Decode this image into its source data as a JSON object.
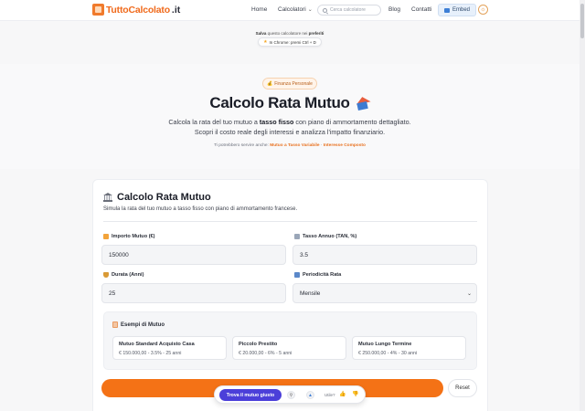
{
  "header": {
    "logo_text": "TuttoCalcolato",
    "logo_tld": ".it",
    "nav": {
      "home": "Home",
      "calcolatori": "Calcolatori",
      "blog": "Blog",
      "contatti": "Contatti"
    },
    "search_placeholder": "Cerca calcolatore",
    "embed_label": "Embed"
  },
  "save_hint": {
    "prefix": "Salva",
    "middle": " questo calcolatore nei ",
    "strong": "preferiti",
    "chrome_text": "In Chrome: premi Ctrl + D"
  },
  "hero": {
    "badge": "Finanza Personale",
    "title": "Calcolo Rata Mutuo",
    "subtitle_1a": "Calcola la rata del tuo mutuo a ",
    "subtitle_1b": "tasso fisso",
    "subtitle_1c": " con piano di ammortamento dettagliato.",
    "subtitle_2": "Scopri il costo reale degli interessi e analizza l'impatto finanziario.",
    "related_prefix": "Ti potrebbero servire anche:",
    "related_1": "Mutuo a Tasso Variabile",
    "related_sep": " · ",
    "related_2": "Interesse Composto"
  },
  "card": {
    "title": "Calcolo Rata Mutuo",
    "description": "Simula la rata del tuo mutuo a tasso fisso con piano di ammortamento francese.",
    "fields": {
      "importo": {
        "label": "Importo Mutuo (€)",
        "value": "150000"
      },
      "tasso": {
        "label": "Tasso Annuo (TAN, %)",
        "value": "3.5"
      },
      "durata": {
        "label": "Durata (Anni)",
        "value": "25"
      },
      "periodicita": {
        "label": "Periodicità Rata",
        "value": "Mensile"
      }
    },
    "examples": {
      "title": "Esempi di Mutuo",
      "items": [
        {
          "name": "Mutuo Standard Acquisto Casa",
          "detail": "€ 150.000,00 - 3.5% - 25 anni"
        },
        {
          "name": "Piccolo Prestito",
          "detail": "€ 20.000,00 - 6% - 5 anni"
        },
        {
          "name": "Mutuo Lungo Termine",
          "detail": "€ 250.000,00 - 4% - 30 anni"
        }
      ]
    },
    "reset_label": "Reset"
  },
  "floating": {
    "find_label": "Trova il mutuo giusto",
    "useful_label": "Utile?"
  },
  "colors": {
    "accent": "#f47216",
    "brand": "#f06a1c",
    "floating_button": "#4b3fd9"
  }
}
